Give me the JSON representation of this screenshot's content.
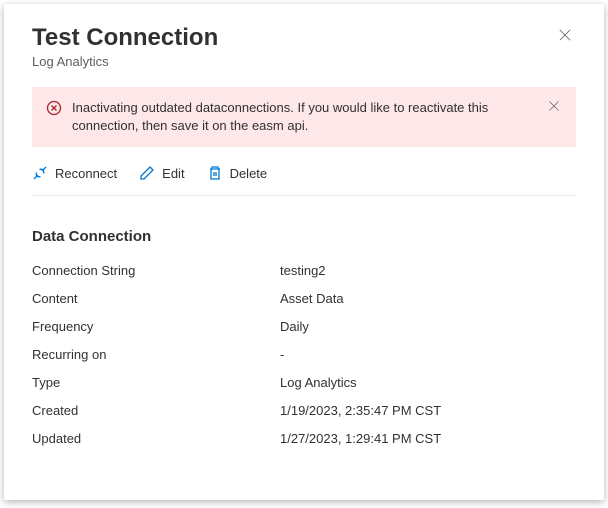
{
  "header": {
    "title": "Test Connection",
    "subtitle": "Log Analytics"
  },
  "alert": {
    "message": "Inactivating outdated dataconnections. If you would like to reactivate this connection, then save it on the easm api."
  },
  "toolbar": {
    "reconnect": "Reconnect",
    "edit": "Edit",
    "delete": "Delete"
  },
  "section": {
    "title": "Data Connection",
    "fields": [
      {
        "label": "Connection String",
        "value": "testing2"
      },
      {
        "label": "Content",
        "value": "Asset Data"
      },
      {
        "label": "Frequency",
        "value": "Daily"
      },
      {
        "label": "Recurring on",
        "value": "-"
      },
      {
        "label": "Type",
        "value": "Log Analytics"
      },
      {
        "label": "Created",
        "value": "1/19/2023, 2:35:47 PM CST"
      },
      {
        "label": "Updated",
        "value": "1/27/2023, 1:29:41 PM CST"
      }
    ]
  }
}
